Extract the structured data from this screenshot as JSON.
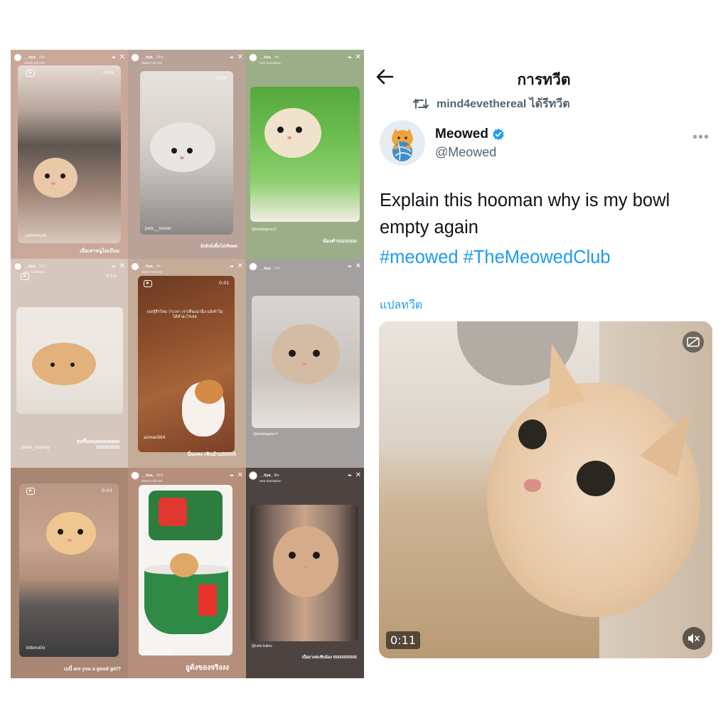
{
  "stories": [
    {
      "user": "__tiya_",
      "time": "33s",
      "sub": "Watch full reel",
      "duration": "0:09",
      "handle": "catversum",
      "caption": "เมื่อเหาหนูไม่เบ๊นม"
    },
    {
      "user": "__tiya_",
      "time": "55m",
      "sub": "Watch full reel",
      "duration": "0:04",
      "handle": "pets__loover",
      "caption": "ยังยังนั่งยิ้มไม่เกิดคด"
    },
    {
      "user": "__tiya_",
      "time": "4m",
      "sub": "See translation",
      "duration": "",
      "handle": "@kimbingmeo7",
      "caption": "น้องคำบนบบบบ"
    },
    {
      "user": "__tiya_",
      "time": "16m",
      "sub": "See translation",
      "duration": "0:14",
      "handle": "shiba_charmy",
      "caption": "ขอขึ้นหน่อยยยยยยยย 555555555"
    },
    {
      "user": "__tiya_",
      "time": "4h",
      "sub": "Watch full reel",
      "duration": "0:01",
      "handle": "azman564",
      "caption": "นี่นะคะ เซินม้วน55555",
      "overlay": "เธอรู้สึกไหม ว่าเวลา เราเห็นแมวนิ่ง แม้เค้าไม่ได้ทำอะไรเลย"
    },
    {
      "user": "__tiya_",
      "time": "17s",
      "sub": "",
      "duration": "",
      "handle": "@kimbingmeo7",
      "caption": ""
    },
    {
      "user": "",
      "time": "",
      "sub": "",
      "duration": "0:03",
      "handle": "kitteno0o",
      "caption": "เบบี๋ are you a good girl?"
    },
    {
      "user": "__tiya_",
      "time": "16m",
      "sub": "Watch full reel",
      "duration": "",
      "handle": "shiba_charmy",
      "caption": "อูด้งของจริงงง"
    },
    {
      "user": "__tiya_",
      "time": "8m",
      "sub": "See translation",
      "duration": "",
      "handle": "@cats.kuties",
      "caption": "เบื่อมากค่ะทีบน้อง 55555555555"
    }
  ],
  "tweet": {
    "title": "การทวีต",
    "retweeter": "mind4evethereal ได้รีทวีต",
    "name": "Meowed",
    "handle": "@Meowed",
    "text": "Explain this hooman why is my bowl empty again",
    "hashtags": "#meowed #TheMeowedClub",
    "translate": "แปลทวีต",
    "video_time": "0:11",
    "icons": [
      "back-arrow-icon",
      "retweet-icon",
      "verified-icon",
      "more-icon",
      "captions-icon",
      "mute-icon"
    ],
    "colors": {
      "accent": "#1d9bf0",
      "text": "#0f1419",
      "muted": "#536471"
    }
  }
}
